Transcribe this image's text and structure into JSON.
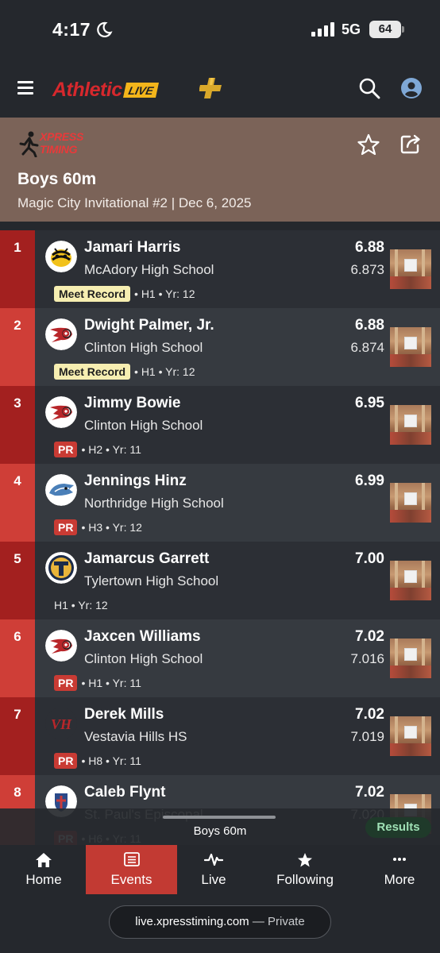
{
  "status_bar": {
    "time": "4:17",
    "network": "5G",
    "battery": "64"
  },
  "header": {
    "brand_main": "Athletic",
    "brand_sub": "LIVE"
  },
  "host": {
    "line1": "XPRESS",
    "line2": "TIMING"
  },
  "event": {
    "title": "Boys 60m",
    "subtitle": "Magic City Invitational #2 | Dec 6, 2025"
  },
  "results": [
    {
      "place": "1",
      "name": "Jamari Harris",
      "school": "McAdory High School",
      "mark": "6.88",
      "detail": "6.873",
      "badge": "Meet Record",
      "badge_type": "record",
      "meta": " • H1 • Yr: 12"
    },
    {
      "place": "2",
      "name": "Dwight Palmer, Jr.",
      "school": "Clinton High School",
      "mark": "6.88",
      "detail": "6.874",
      "badge": "Meet Record",
      "badge_type": "record",
      "meta": " • H1 • Yr: 12"
    },
    {
      "place": "3",
      "name": "Jimmy Bowie",
      "school": "Clinton High School",
      "mark": "6.95",
      "detail": "",
      "badge": "PR",
      "badge_type": "pr",
      "meta": " • H2 • Yr: 11"
    },
    {
      "place": "4",
      "name": "Jennings Hinz",
      "school": "Northridge High School",
      "mark": "6.99",
      "detail": "",
      "badge": "PR",
      "badge_type": "pr",
      "meta": " • H3 • Yr: 12"
    },
    {
      "place": "5",
      "name": "Jamarcus Garrett",
      "school": "Tylertown High School",
      "mark": "7.00",
      "detail": "",
      "badge": "",
      "badge_type": "none",
      "meta": "H1 • Yr: 12"
    },
    {
      "place": "6",
      "name": "Jaxcen Williams",
      "school": "Clinton High School",
      "mark": "7.02",
      "detail": "7.016",
      "badge": "PR",
      "badge_type": "pr",
      "meta": " • H1 • Yr: 11"
    },
    {
      "place": "7",
      "name": "Derek Mills",
      "school": "Vestavia Hills HS",
      "mark": "7.02",
      "detail": "7.019",
      "badge": "PR",
      "badge_type": "pr",
      "meta": " • H8 • Yr: 11"
    },
    {
      "place": "8",
      "name": "Caleb Flynt",
      "school": "St. Paul's Episcopal",
      "mark": "7.02",
      "detail": "7.020",
      "badge": "PR",
      "badge_type": "pr",
      "meta": " • H6 • Yr: 11"
    }
  ],
  "now_strip": {
    "label": "Boys 60m",
    "results_button": "Results"
  },
  "nav": [
    {
      "label": "Home",
      "icon": "home-icon"
    },
    {
      "label": "Events",
      "icon": "list-icon"
    },
    {
      "label": "Live",
      "icon": "pulse-icon"
    },
    {
      "label": "Following",
      "icon": "star-icon"
    },
    {
      "label": "More",
      "icon": "more-icon"
    }
  ],
  "browser": {
    "host": "live.xpresstiming.com",
    "private": " — Private"
  },
  "colors": {
    "accent_red": "#c23a33",
    "meet_header": "#7b6358",
    "meet_record_badge": "#f6eeb1",
    "results_pill_text": "#9fe0b5"
  }
}
